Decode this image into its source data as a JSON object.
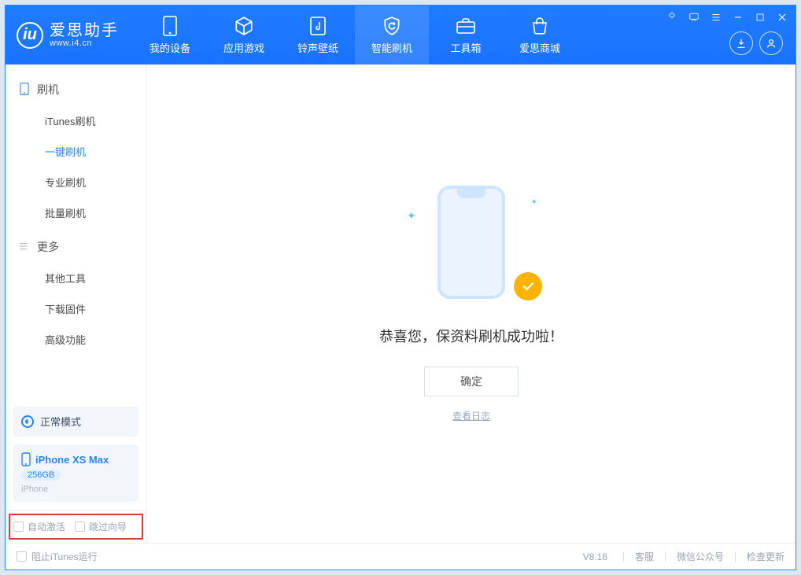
{
  "brand": {
    "name": "爱思助手",
    "url": "www.i4.cn",
    "logo_letter": "iu"
  },
  "tabs": {
    "device": "我的设备",
    "apps": "应用游戏",
    "ringwall": "铃声壁纸",
    "flash": "智能刷机",
    "tools": "工具箱",
    "store": "爱思商城"
  },
  "sidebar": {
    "flash_group": "刷机",
    "more_group": "更多",
    "items": {
      "itunes": "iTunes刷机",
      "onekey": "一键刷机",
      "pro": "专业刷机",
      "batch": "批量刷机",
      "other": "其他工具",
      "fw": "下载固件",
      "adv": "高级功能"
    }
  },
  "device": {
    "mode": "正常模式",
    "name": "iPhone XS Max",
    "storage": "256GB",
    "kind": "iPhone"
  },
  "bottom_opts": {
    "auto_activate": "自动激活",
    "skip_guide": "跳过向导"
  },
  "main": {
    "message": "恭喜您，保资料刷机成功啦！",
    "ok": "确定",
    "view_log": "查看日志"
  },
  "footer": {
    "block_itunes": "阻止iTunes运行",
    "version": "V8.16",
    "support": "客服",
    "wechat": "微信公众号",
    "update": "检查更新"
  }
}
